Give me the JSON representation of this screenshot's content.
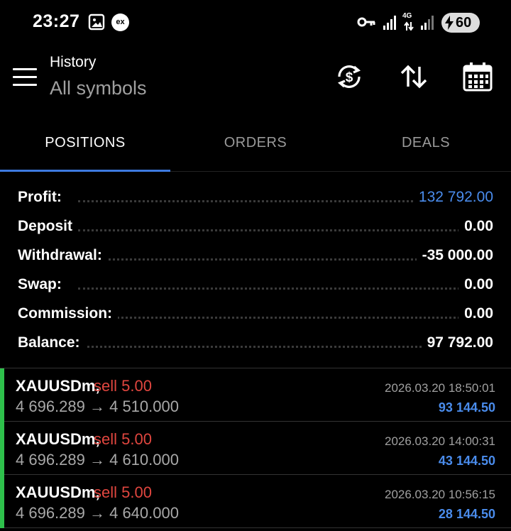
{
  "status_bar": {
    "time": "23:27",
    "notification_icons": [
      "gallery-icon",
      "ex-app-icon"
    ],
    "ex_label": "ex",
    "network_label": "4G",
    "battery": "60"
  },
  "toolbar": {
    "title": "History",
    "subtitle": "All symbols",
    "actions": [
      "currency-exchange-icon",
      "sort-icon",
      "calendar-icon"
    ]
  },
  "tabs": [
    {
      "label": "POSITIONS",
      "active": true
    },
    {
      "label": "ORDERS",
      "active": false
    },
    {
      "label": "DEALS",
      "active": false
    }
  ],
  "summary": {
    "profit": {
      "label": "Profit:",
      "value": "132 792.00"
    },
    "deposit": {
      "label": "Deposit",
      "value": "0.00"
    },
    "withdrawal": {
      "label": "Withdrawal:",
      "value": "-35 000.00"
    },
    "swap": {
      "label": "Swap:",
      "value": "0.00"
    },
    "commission": {
      "label": "Commission:",
      "value": "0.00"
    },
    "balance": {
      "label": "Balance:",
      "value": "97 792.00"
    }
  },
  "positions": [
    {
      "symbol": "XAUUSDm,",
      "side": "sell 5.00",
      "prices": "4 696.289 → 4 510.000",
      "time": "2026.03.20 18:50:01",
      "profit": "93 144.50"
    },
    {
      "symbol": "XAUUSDm,",
      "side": "sell 5.00",
      "prices": "4 696.289 → 4 610.000",
      "time": "2026.03.20 14:00:31",
      "profit": "43 144.50"
    },
    {
      "symbol": "XAUUSDm,",
      "side": "sell 5.00",
      "prices": "4 696.289 → 4 640.000",
      "time": "2026.03.20 10:56:15",
      "profit": "28 144.50"
    }
  ],
  "colors": {
    "accent": "#3d7ae0",
    "profit_blue": "#4a8cec",
    "sell_red": "#e0463f",
    "position_bar_green": "#2ec04b"
  }
}
